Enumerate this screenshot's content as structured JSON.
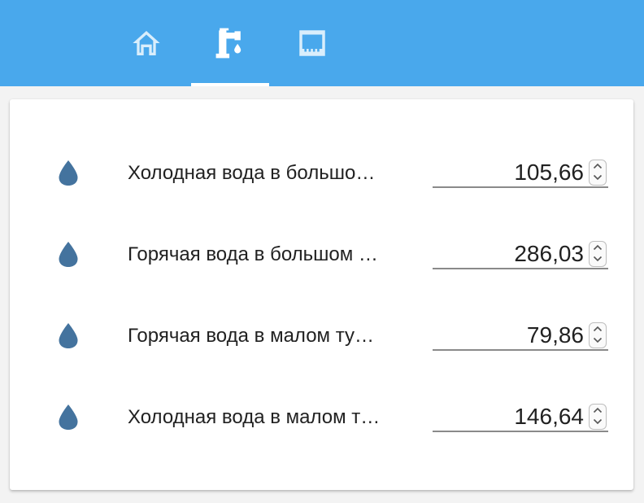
{
  "tabs": [
    {
      "icon": "home-icon"
    },
    {
      "icon": "water-pump-icon",
      "selected": true
    },
    {
      "icon": "ethernet-icon"
    }
  ],
  "colors": {
    "header": "#49a8ec",
    "tab_icon": "#ffffff",
    "drop_icon": "#44739e",
    "underline": "#8a8a8a"
  },
  "meters": [
    {
      "label": "Холодная вода в большо…",
      "value": "105,66",
      "icon": "water-drop-icon"
    },
    {
      "label": "Горячая вода в большом …",
      "value": "286,03",
      "icon": "water-drop-icon"
    },
    {
      "label": "Горячая вода в малом ту…",
      "value": "79,86",
      "icon": "water-drop-icon"
    },
    {
      "label": "Холодная вода в малом т…",
      "value": "146,64",
      "icon": "water-drop-icon"
    }
  ]
}
